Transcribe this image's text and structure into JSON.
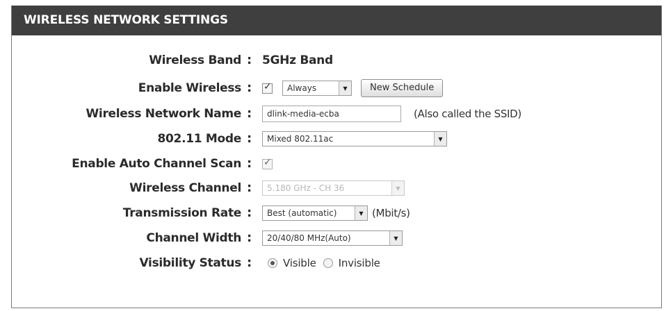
{
  "section_title": "WIRELESS NETWORK SETTINGS",
  "colon": ":",
  "fields": {
    "wireless_band": {
      "label": "Wireless Band",
      "value": "5GHz Band"
    },
    "enable_wireless": {
      "label": "Enable Wireless",
      "checked": true,
      "schedule": "Always",
      "new_schedule_button": "New Schedule"
    },
    "network_name": {
      "label": "Wireless Network Name",
      "value": "dlink-media-ecba",
      "hint": "(Also called the SSID)"
    },
    "mode": {
      "label": "802.11 Mode",
      "value": "Mixed 802.11ac"
    },
    "auto_channel": {
      "label": "Enable Auto Channel Scan",
      "checked": true
    },
    "channel": {
      "label": "Wireless Channel",
      "value": "5.180 GHz - CH 36",
      "disabled": true
    },
    "tx_rate": {
      "label": "Transmission Rate",
      "value": "Best (automatic)",
      "unit": "(Mbit/s)"
    },
    "channel_width": {
      "label": "Channel Width",
      "value": "20/40/80 MHz(Auto)"
    },
    "visibility": {
      "label": "Visibility Status",
      "options": [
        "Visible",
        "Invisible"
      ],
      "selected": "Visible"
    }
  }
}
